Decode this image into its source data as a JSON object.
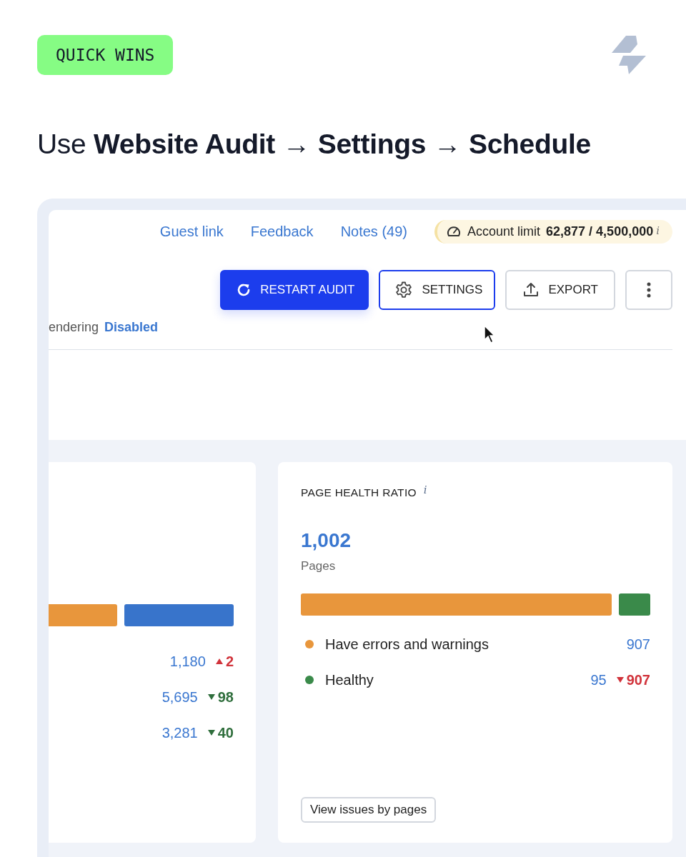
{
  "badge": "QUICK WINS",
  "heading": "Use **Website Audit** → **Settings** → **Schedule**",
  "links": [
    "Guest link",
    "Feedback",
    "Notes (49)"
  ],
  "account_limit": {
    "label": "Account limit",
    "value": "62,877 / 4,500,000",
    "info": "i"
  },
  "buttons": [
    {
      "kind": "primary",
      "label": "RESTART AUDIT"
    },
    {
      "kind": "outlined",
      "label": "SETTINGS"
    },
    {
      "kind": "export",
      "label": "EXPORT"
    },
    {
      "kind": "more"
    }
  ],
  "rendering": {
    "label": "endering",
    "value": "Disabled"
  },
  "left_card": {
    "bar": [
      {
        "color": "#e8963c"
      },
      {
        "color": "#3874cb"
      }
    ],
    "rows": [
      {
        "value": "1,180",
        "change": {
          "text": "2",
          "kind": "up",
          "color": "#d1333b"
        }
      },
      {
        "value": "5,695",
        "change": {
          "text": "98",
          "kind": "down",
          "color": "#2f6e3c"
        }
      },
      {
        "value": "3,281",
        "change": {
          "text": "40",
          "kind": "down",
          "color": "#2f6e3c"
        }
      }
    ]
  },
  "health_card": {
    "title": "PAGE HEALTH RATIO",
    "info": "i",
    "total": "1,002",
    "unit": "Pages",
    "bar": [
      {
        "color": "#e8963c"
      },
      {
        "color": "#3a8a4a"
      }
    ],
    "legend": [
      {
        "label": "Have errors and warnings",
        "color": "#e8963c",
        "value": "907"
      },
      {
        "label": "Healthy",
        "color": "#3a8a4a",
        "value": "95",
        "change": {
          "text": "907",
          "kind": "down",
          "color": "#d1333b"
        }
      }
    ],
    "button": "View issues by pages"
  }
}
